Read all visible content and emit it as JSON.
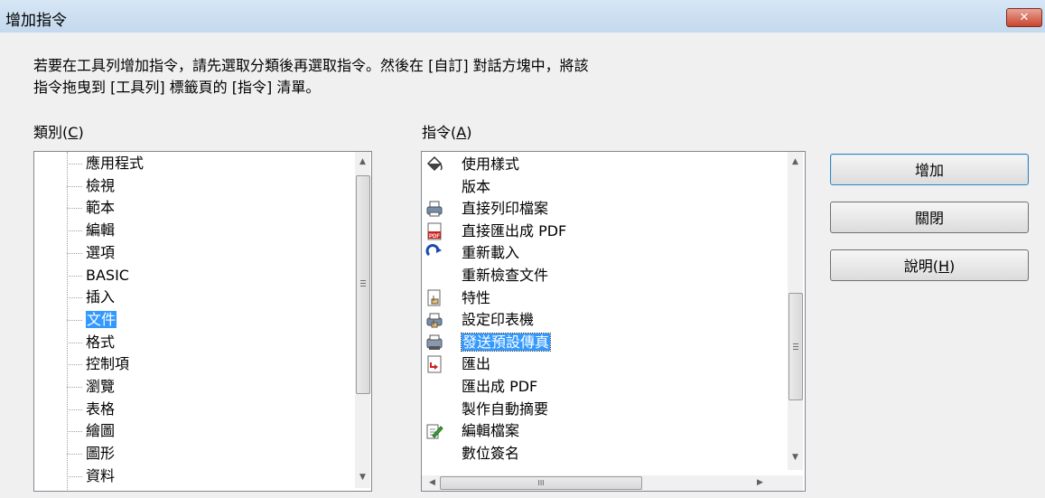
{
  "window": {
    "title": "增加指令",
    "close_symbol": "✕"
  },
  "instruction": {
    "line1": "若要在工具列增加指令，請先選取分類後再選取指令。然後在 [自訂] 對話方塊中，將該",
    "line2": "指令拖曳到 [工具列] 標籤頁的 [指令] 清單。"
  },
  "category_label": {
    "text": "類別",
    "hotkey": "C"
  },
  "command_label": {
    "text": "指令",
    "hotkey": "A"
  },
  "categories": [
    "應用程式",
    "檢視",
    "範本",
    "編輯",
    "選項",
    "BASIC",
    "插入",
    "文件",
    "格式",
    "控制項",
    "瀏覽",
    "表格",
    "繪圖",
    "圖形",
    "資料"
  ],
  "selected_category": "文件",
  "commands": [
    {
      "label": "使用樣式",
      "icon": "paint-bucket-icon"
    },
    {
      "label": "版本",
      "icon": ""
    },
    {
      "label": "直接列印檔案",
      "icon": "printer-icon"
    },
    {
      "label": "直接匯出成 PDF",
      "icon": "pdf-icon"
    },
    {
      "label": "重新載入",
      "icon": "reload-icon"
    },
    {
      "label": "重新檢查文件",
      "icon": ""
    },
    {
      "label": "特性",
      "icon": "properties-icon"
    },
    {
      "label": "設定印表機",
      "icon": "printer-setup-icon"
    },
    {
      "label": "發送預設傳真",
      "icon": "fax-icon"
    },
    {
      "label": "匯出",
      "icon": "export-icon"
    },
    {
      "label": "匯出成 PDF",
      "icon": ""
    },
    {
      "label": "製作自動摘要",
      "icon": ""
    },
    {
      "label": "編輯檔案",
      "icon": "edit-file-icon"
    },
    {
      "label": "數位簽名",
      "icon": ""
    }
  ],
  "selected_command": "發送預設傳真",
  "buttons": {
    "add": "增加",
    "close": "關閉",
    "help": {
      "text": "說明",
      "hotkey": "H"
    }
  },
  "scrollbar_glyphs": {
    "up": "▲",
    "down": "▼",
    "left": "◀",
    "right": "▶",
    "grip": "III"
  }
}
